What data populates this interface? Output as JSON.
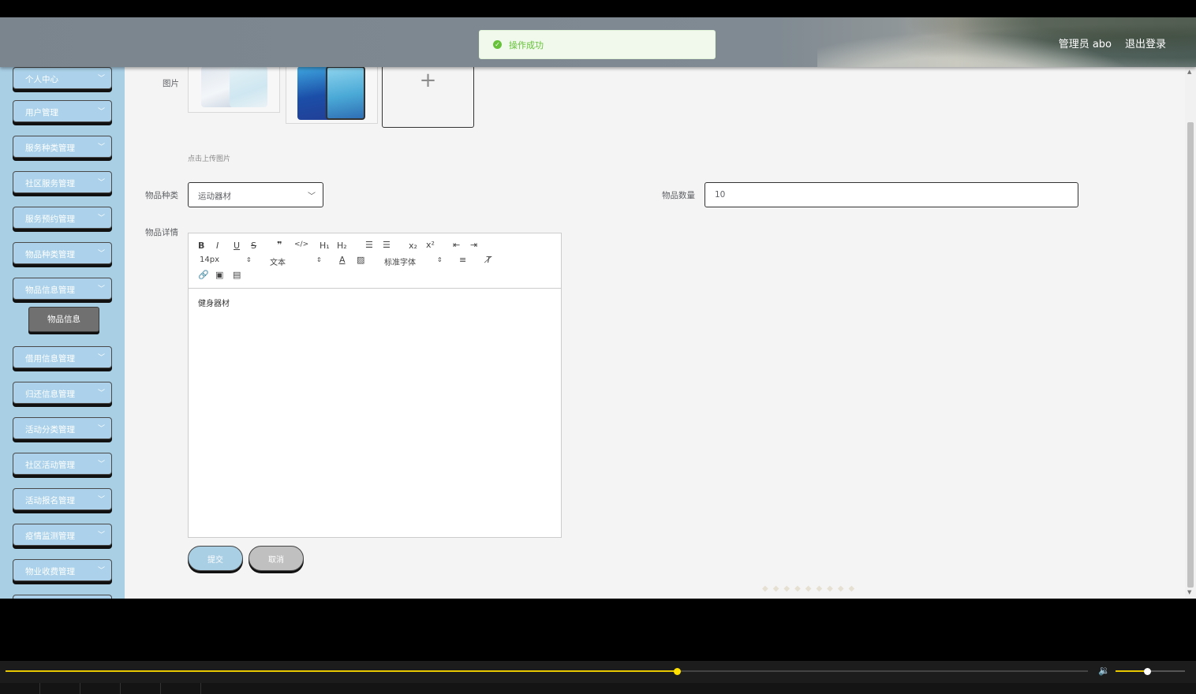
{
  "header": {
    "admin_label": "管理员 abo",
    "logout_label": "退出登录"
  },
  "toast": {
    "message": "操作成功",
    "status_color": "#67c23a"
  },
  "sidebar": {
    "accent_color": "#a9cfe5",
    "items": [
      {
        "label": "个人中心"
      },
      {
        "label": "用户管理"
      },
      {
        "label": "服务种类管理"
      },
      {
        "label": "社区服务管理"
      },
      {
        "label": "服务预约管理"
      },
      {
        "label": "物品种类管理"
      },
      {
        "label": "物品信息管理"
      },
      {
        "label": "借用信息管理"
      },
      {
        "label": "归还信息管理"
      },
      {
        "label": "活动分类管理"
      },
      {
        "label": "社区活动管理"
      },
      {
        "label": "活动报名管理"
      },
      {
        "label": "疫情监测管理"
      },
      {
        "label": "物业收费管理"
      }
    ],
    "active_sub": {
      "label": "物品信息"
    }
  },
  "form": {
    "image_label": "图片",
    "upload_hint": "点击上传图片",
    "category_label": "物品种类",
    "category_value": "运动器材",
    "quantity_label": "物品数量",
    "quantity_value": "10",
    "detail_label": "物品详情",
    "editor": {
      "font_size": "14px",
      "text_type": "文本",
      "font_family": "标准字体",
      "content": "健身器材"
    },
    "submit_label": "提交",
    "cancel_label": "取消"
  },
  "player": {
    "progress": 0.62,
    "volume": 0.45
  }
}
